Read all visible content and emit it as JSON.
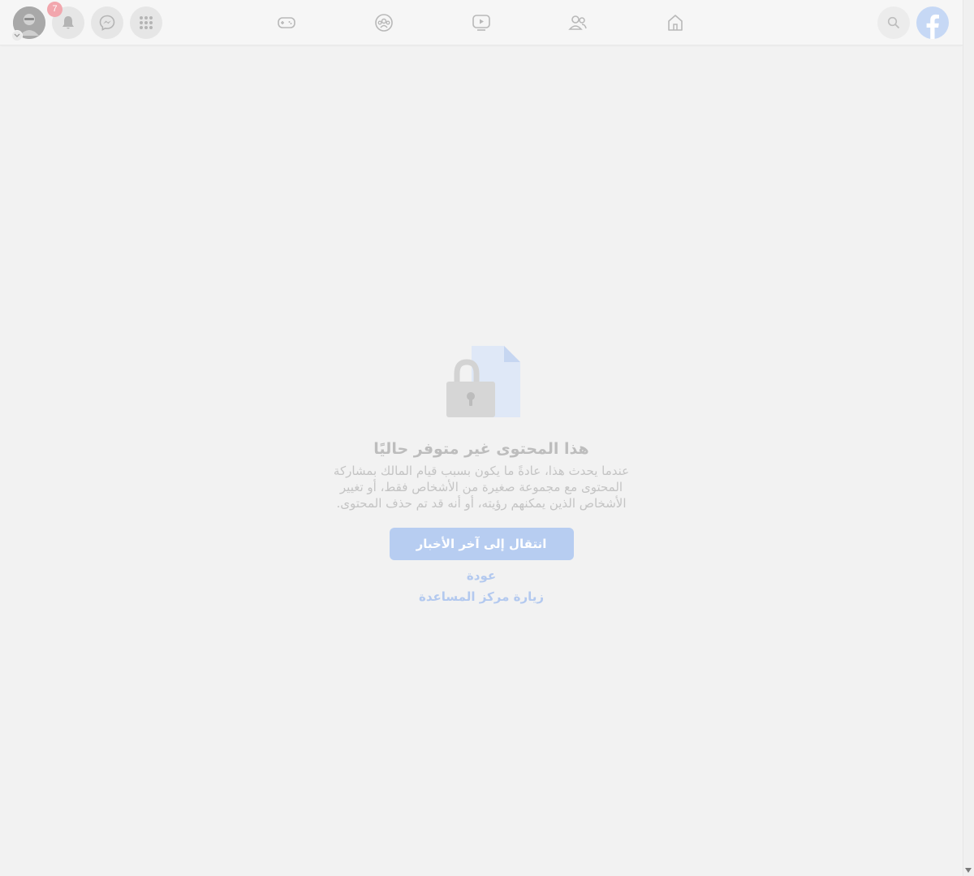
{
  "topbar": {
    "notifications_count": "7",
    "icons": {
      "avatar": "profile-avatar",
      "account_menu": "chevron-down-icon",
      "notifications": "bell-icon",
      "messenger": "messenger-icon",
      "menu": "grid-menu-icon",
      "gaming": "gamepad-icon",
      "groups": "groups-icon",
      "watch": "video-play-icon",
      "friends": "friends-icon",
      "home": "home-icon",
      "search": "search-icon",
      "logo": "facebook-logo"
    }
  },
  "content": {
    "title": "هذا المحتوى غير متوفر حاليًا",
    "description": "عندما يحدث هذا، عادةً ما يكون بسبب قيام المالك بمشاركة المحتوى مع مجموعة صغيرة من الأشخاص فقط، أو تغيير الأشخاص الذين يمكنهم رؤيته، أو أنه قد تم حذف المحتوى.",
    "primary_button": "انتقال إلى آخر الأخبار",
    "back_link": "عودة",
    "help_link": "زيارة مركز المساعدة",
    "illustration": "locked-document-icon"
  },
  "colors": {
    "background": "#f2f2f2",
    "primary": "#b7cdf1",
    "link": "#b3c9ef",
    "badge": "#f2a6ad",
    "brand": "#c6d8f5"
  }
}
